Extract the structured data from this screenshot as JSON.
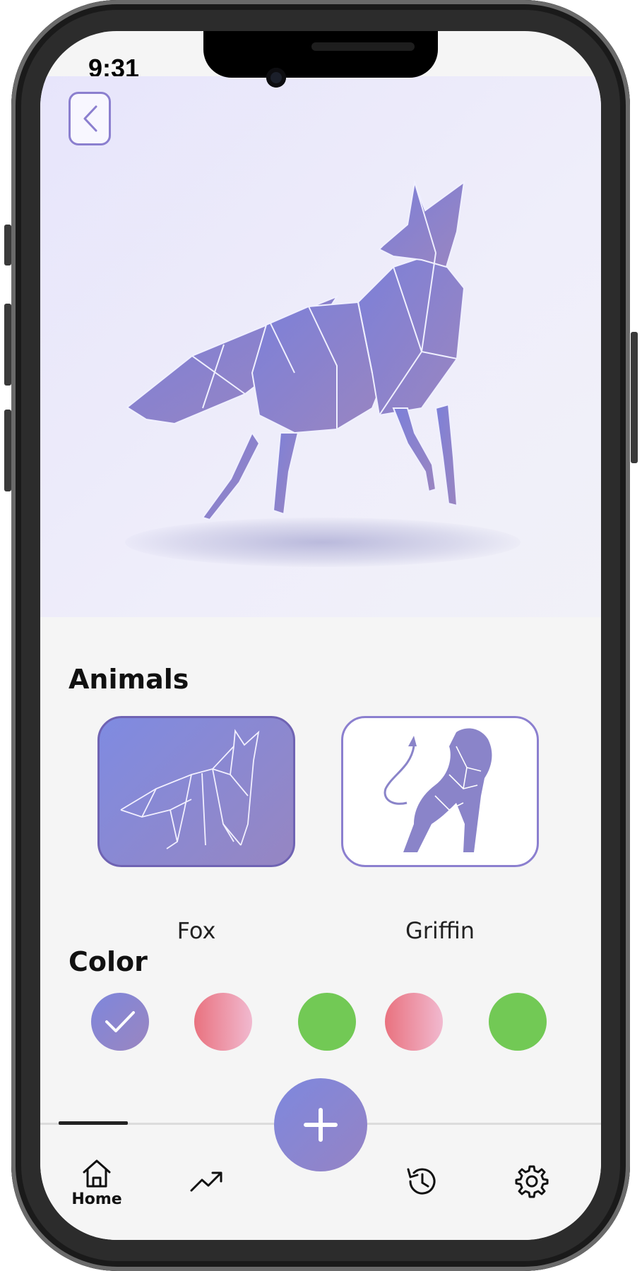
{
  "status_bar": {
    "time": "9:31"
  },
  "hero": {
    "subject": "Fox",
    "back_icon": "chevron-left-icon"
  },
  "animals_section": {
    "title": "Animals",
    "items": [
      {
        "label": "Fox",
        "selected": true
      },
      {
        "label": "Griffin",
        "selected": false
      }
    ]
  },
  "color_section": {
    "title": "Color",
    "swatches": [
      {
        "color": "#8a84c9",
        "selected": true
      },
      {
        "color": "#ea7a8a",
        "selected": false
      },
      {
        "color": "#72c955",
        "selected": false
      },
      {
        "color": "#ea7a8a",
        "selected": false
      },
      {
        "color": "#72c955",
        "selected": false
      }
    ]
  },
  "tab_bar": {
    "items": [
      {
        "label": "Home",
        "icon": "home-icon",
        "active": true
      },
      {
        "label": "",
        "icon": "trending-up-icon",
        "active": false
      },
      {
        "label": "",
        "icon": "history-icon",
        "active": false
      },
      {
        "label": "",
        "icon": "settings-icon",
        "active": false
      }
    ],
    "fab_icon": "plus-icon"
  },
  "colors": {
    "accent": "#8b7fcf",
    "background": "#f5f5f5"
  }
}
